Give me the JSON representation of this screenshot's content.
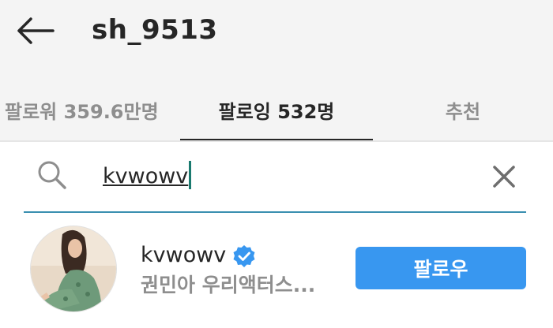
{
  "header": {
    "title": "sh_9513"
  },
  "tabs": [
    {
      "label": "팔로워 359.6만명"
    },
    {
      "label": "팔로잉 532명"
    },
    {
      "label": "추천"
    }
  ],
  "search": {
    "value": "kvwowv"
  },
  "results": [
    {
      "username": "kvwowv",
      "full_name": "권민아 우리액터스...",
      "verified": true,
      "button_label": "팔로우"
    }
  ],
  "colors": {
    "accent": "#3897f0",
    "search_underline": "#3a8fb0",
    "header_bg": "#f4f4f4",
    "muted_text": "#8e8e8e"
  }
}
